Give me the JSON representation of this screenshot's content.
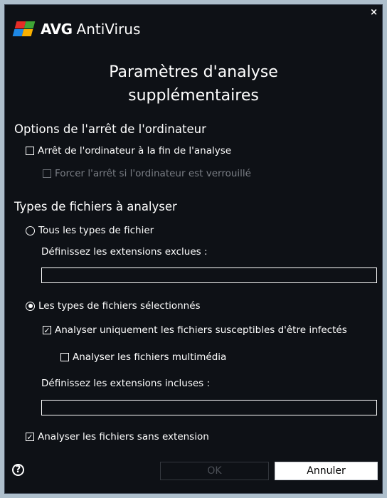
{
  "window": {
    "brand_name": "AVG",
    "brand_product": "AntiVirus",
    "close_glyph": "×",
    "title_line1": "Paramètres d'analyse",
    "title_line2": "supplémentaires"
  },
  "shutdown": {
    "heading": "Options de l'arrêt de l'ordinateur",
    "shutdown_label": "Arrêt de l'ordinateur à la fin de l'analyse",
    "shutdown_checked": false,
    "force_label": "Forcer l'arrêt si l'ordinateur est verrouillé",
    "force_checked": false,
    "force_disabled": true
  },
  "file_types": {
    "heading": "Types de fichiers à analyser",
    "all_types_label": "Tous les types de fichier",
    "all_types_selected": false,
    "excluded_label": "Définissez les extensions exclues :",
    "excluded_value": "",
    "selected_types_label": "Les types de fichiers sélectionnés",
    "selected_types_selected": true,
    "infectable_label": "Analyser uniquement les fichiers susceptibles d'être infectés",
    "infectable_checked": true,
    "multimedia_label": "Analyser les fichiers multimédia",
    "multimedia_checked": false,
    "included_label": "Définissez les extensions incluses :",
    "included_value": "",
    "no_extension_label": "Analyser les fichiers sans extension",
    "no_extension_checked": true
  },
  "footer": {
    "help_glyph": "?",
    "ok_label": "OK",
    "ok_disabled": true,
    "cancel_label": "Annuler"
  },
  "colors": {
    "background": "#0e1116",
    "page_border": "#aebfcc",
    "text": "#ffffff",
    "disabled_text": "#7a7e85",
    "logo_red": "#e52d27",
    "logo_green": "#3fa535",
    "logo_blue": "#1e88e5",
    "logo_yellow": "#f9b000"
  }
}
